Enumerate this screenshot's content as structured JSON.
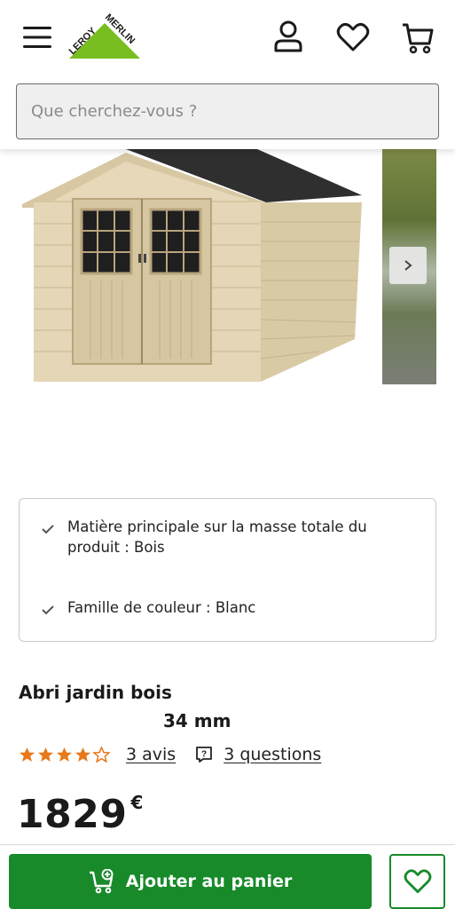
{
  "header": {
    "logo_text": "LEROY MERLIN",
    "brand_color": "#78be20",
    "icons": [
      "menu-icon",
      "account-icon",
      "heart-icon",
      "cart-icon"
    ]
  },
  "search": {
    "placeholder": "Que cherchez-vous ?"
  },
  "features": [
    {
      "text": "Matière principale sur la masse totale du produit : Bois"
    },
    {
      "text": "Famille de couleur : Blanc"
    }
  ],
  "product": {
    "title_line1": "Abri jardin bois",
    "title_line2": "34 mm",
    "reviews_label": "3 avis",
    "questions_label": "3 questions",
    "rating": 4.5,
    "rating_max": 5,
    "price": "1829",
    "currency": "€"
  },
  "actions": {
    "add_to_cart_label": "Ajouter au panier",
    "accent_color": "#188a2a"
  }
}
